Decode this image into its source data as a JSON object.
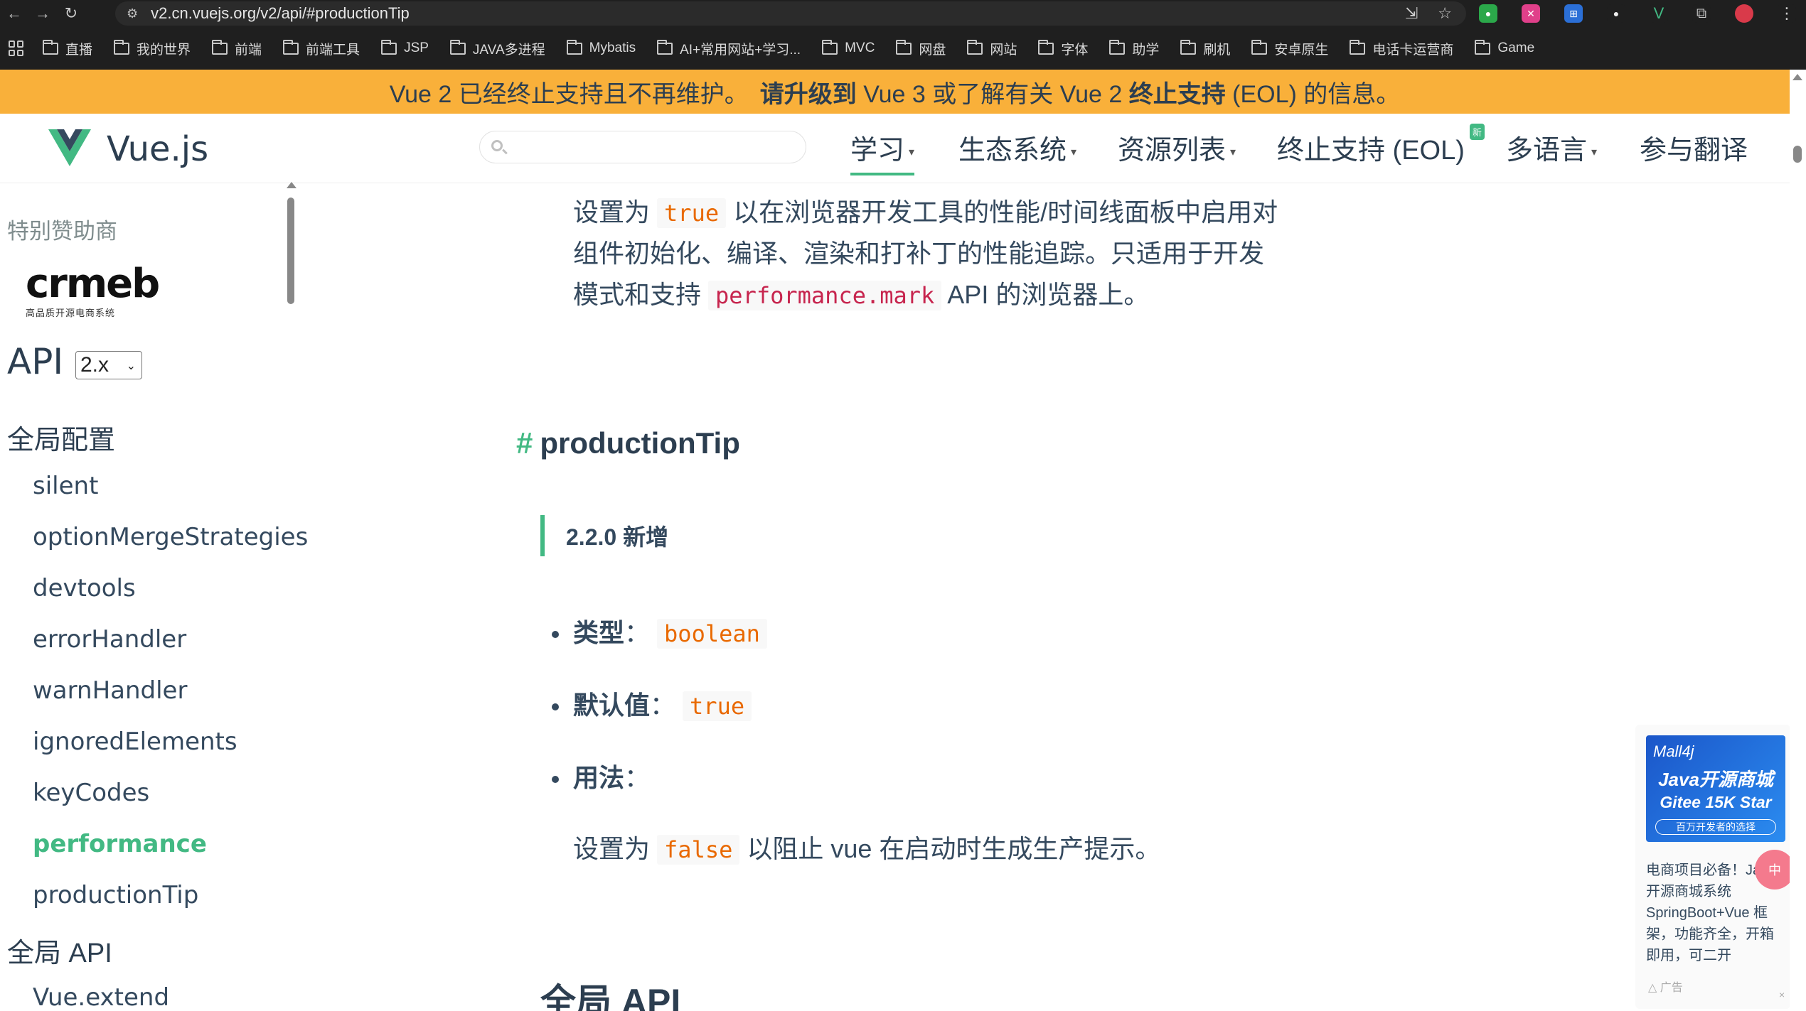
{
  "browser": {
    "url": "v2.cn.vuejs.org/v2/api/#productionTip",
    "bookmarks": [
      "直播",
      "我的世界",
      "前端",
      "前端工具",
      "JSP",
      "JAVA多进程",
      "Mybatis",
      "AI+常用网站+学习...",
      "MVC",
      "网盘",
      "网站",
      "字体",
      "助学",
      "刷机",
      "安卓原生",
      "电话卡运营商",
      "Game"
    ]
  },
  "banner": {
    "part1": "Vue 2 已经终止支持且不再维护。",
    "link1": "请升级到",
    "part2": " Vue 3 或了解有关 Vue 2 ",
    "link2": "终止支持",
    "part3": " (EOL) 的信息。"
  },
  "header": {
    "logo_text": "Vue.js",
    "search_placeholder": "",
    "nav": {
      "learn": "学习",
      "ecosystem": "生态系统",
      "resources": "资源列表",
      "eol": "终止支持 (EOL)",
      "eol_badge": "新",
      "languages": "多语言",
      "translate": "参与翻译"
    }
  },
  "sidebar": {
    "sponsor_label": "特别赞助商",
    "sponsor_logo": "crmeb",
    "sponsor_sub": "高品质开源电商系统",
    "api_title": "API",
    "version": "2.x",
    "section_global_config": "全局配置",
    "items": [
      "silent",
      "optionMergeStrategies",
      "devtools",
      "errorHandler",
      "warnHandler",
      "ignoredElements",
      "keyCodes",
      "performance",
      "productionTip"
    ],
    "section_global_api": "全局 API",
    "item_extend": "Vue.extend"
  },
  "content": {
    "perf_line1_pre": "设置为",
    "perf_line1_code": "true",
    "perf_line1_post": "以在浏览器开发工具的性能/时间线面板中启用对",
    "perf_line2": "组件初始化、编译、渲染和打补丁的性能追踪。只适用于开发",
    "perf_line3_pre": "模式和支持",
    "perf_line3_code": "performance.mark",
    "perf_line3_post": "API 的浏览器上。",
    "heading_hash": "#",
    "heading": "productionTip",
    "tip": "2.2.0 新增",
    "type_label": "类型",
    "type_value": "boolean",
    "default_label": "默认值",
    "default_value": "true",
    "usage_label": "用法",
    "usage_pre": "设置为",
    "usage_code": "false",
    "usage_post": "以阻止 vue 在启动时生成生产提示。",
    "next_heading": "全局 API"
  },
  "ad": {
    "brand": "Mall4j",
    "title1": "Java开源商城",
    "title2": "Gitee 15K Star",
    "pill": "百万开发者的选择",
    "text": "电商项目必备！Java开源商城系统SpringBoot+Vue 框架，功能齐全，开箱即用，可二开",
    "label": "广告",
    "close": "×",
    "float_label": "中"
  }
}
